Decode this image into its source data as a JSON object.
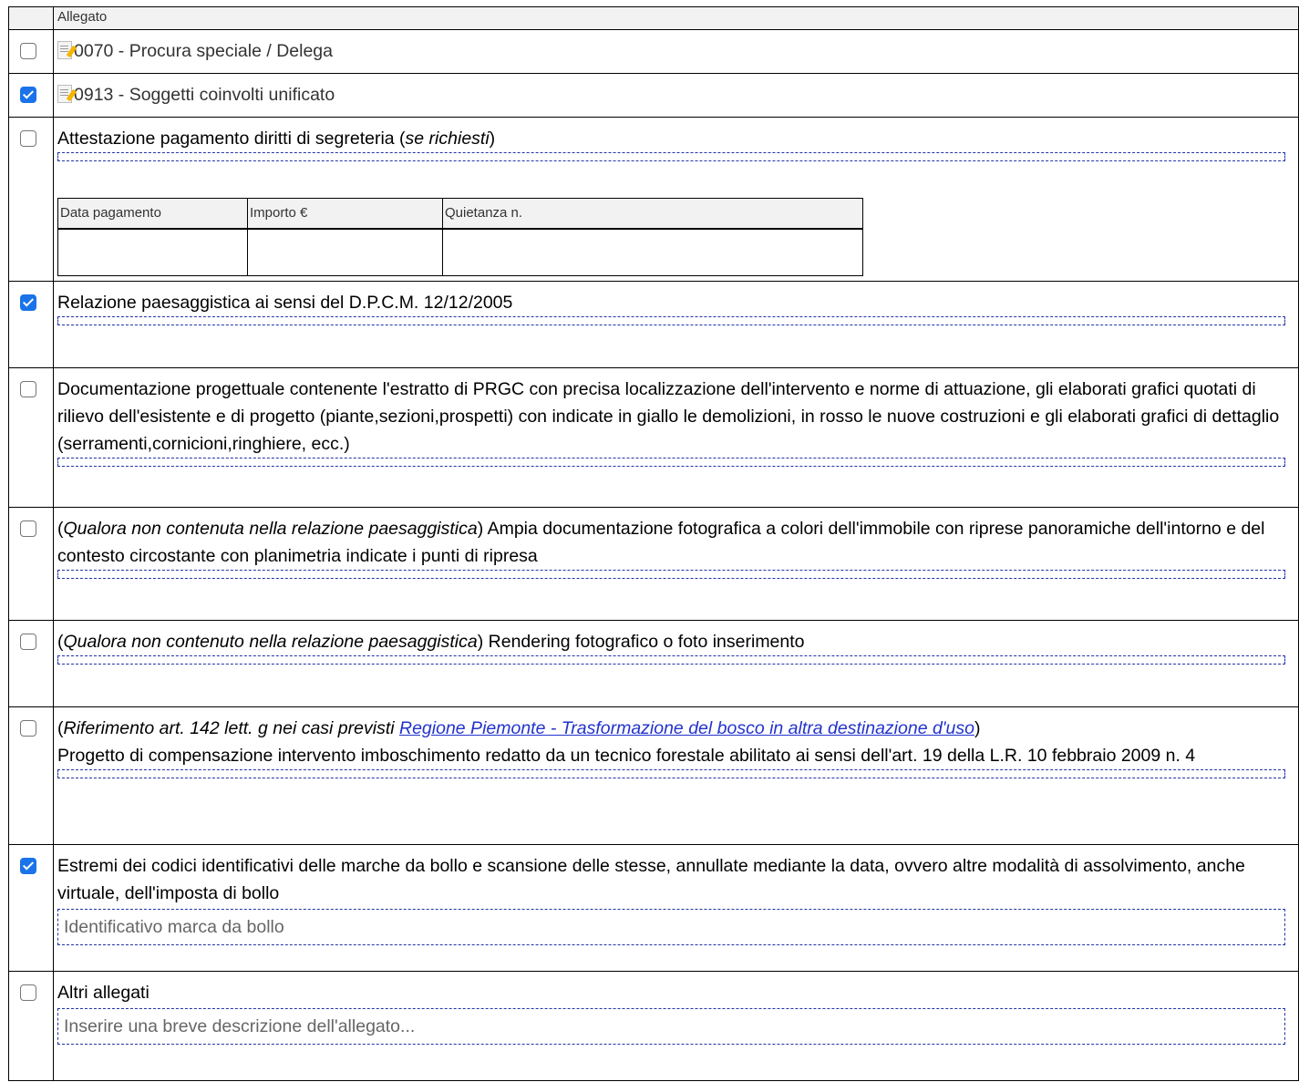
{
  "table": {
    "header_label": "Allegato"
  },
  "rows": [
    {
      "checked": false,
      "title": "0070 - Procura speciale / Delega"
    },
    {
      "checked": true,
      "title": "0913 - Soggetti coinvolti unificato"
    },
    {
      "checked": false,
      "text": "Attestazione pagamento diritti di segreteria (",
      "italic": "se richiesti",
      "after": ")"
    },
    {
      "checked": true,
      "text": "Relazione paesaggistica ai sensi del D.P.C.M. 12/12/2005"
    },
    {
      "checked": false,
      "text": "Documentazione progettuale contenente l'estratto di PRGC con precisa localizzazione dell'intervento e norme di attuazione, gli elaborati grafici quotati di rilievo dell'esistente e di progetto (piante,sezioni,prospetti) con indicate in giallo le demolizioni, in rosso le nuove costruzioni e gli elaborati grafici di dettaglio (serramenti,cornicioni,ringhiere, ecc.)"
    },
    {
      "checked": false,
      "before": "(",
      "italic": "Qualora non contenuta nella relazione paesaggistica",
      "text": ") Ampia documentazione fotografica a colori dell'immobile con riprese panoramiche dell'intorno e del contesto circostante con planimetria indicate i punti di ripresa"
    },
    {
      "checked": false,
      "before": "(",
      "italic": "Qualora non contenuto nella relazione paesaggistica",
      "text": ") Rendering fotografico o foto inserimento"
    },
    {
      "checked": false,
      "before": "(",
      "italic": "Riferimento art. 142 lett. g nei casi previsti ",
      "link": "Regione Piemonte - Trasformazione del bosco in altra destinazione d'uso",
      "after": ")",
      "text": "Progetto di compensazione intervento imboschimento redatto da un tecnico forestale abilitato ai sensi dell'art. 19 della L.R. 10 febbraio 2009 n. 4"
    },
    {
      "checked": true,
      "text": "Estremi dei codici identificativi delle marche da bollo e scansione delle stesse, annullate mediante la data, ovvero altre modalità di assolvimento, anche virtuale, dell'imposta di bollo",
      "field_placeholder": "Identificativo marca da bollo"
    },
    {
      "checked": false,
      "text": "Altri allegati",
      "field_placeholder": "Inserire una breve descrizione dell'allegato..."
    }
  ],
  "payment_table": {
    "headers": [
      "Data pagamento",
      "Importo €",
      "Quietanza n."
    ]
  },
  "colors": {
    "checkbox_checked": "#1a73e8",
    "dashed_border": "#2233aa",
    "link": "#2233cc"
  }
}
